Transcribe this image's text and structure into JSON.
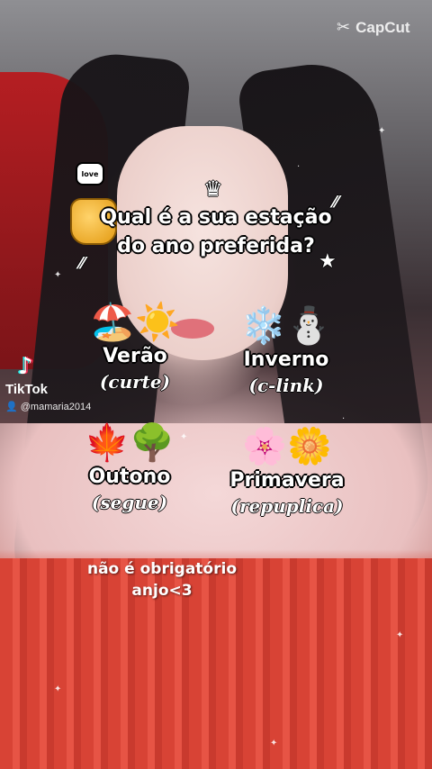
{
  "watermark": {
    "brand": "CapCut",
    "icon": "capcut-logo-icon"
  },
  "question": {
    "line1": "Qual é a sua estação",
    "line2": "do ano preferida?"
  },
  "stickers": {
    "love_bubble": "love",
    "icons": [
      "honey-pot-icon",
      "crown-icon",
      "star-icon"
    ]
  },
  "options": [
    {
      "emoji": "🏖️☀️",
      "name": "Verão",
      "action": "(curte)",
      "icon": "beach-sun-icon"
    },
    {
      "emoji": "❄️⛄",
      "name": "Inverno",
      "action": "(c-link)",
      "icon": "snowflake-snowman-icon"
    },
    {
      "emoji": "🍁🌳",
      "name": "Outono",
      "action": "(segue)",
      "icon": "leaf-tree-icon"
    },
    {
      "emoji": "🌸🌼",
      "name": "Primavera",
      "action": "(repuplica)",
      "icon": "flowers-icon"
    }
  ],
  "note": {
    "line1": "não é obrigatório",
    "line2": "anjo<3"
  },
  "tiktok": {
    "name": "TikTok",
    "username": "@mamaria2014",
    "icon": "tiktok-logo-icon"
  },
  "colors": {
    "text_fill": "#ffffff",
    "text_outline": "#000000",
    "dress_red": "#d84335",
    "seat_red": "#b51e22"
  }
}
